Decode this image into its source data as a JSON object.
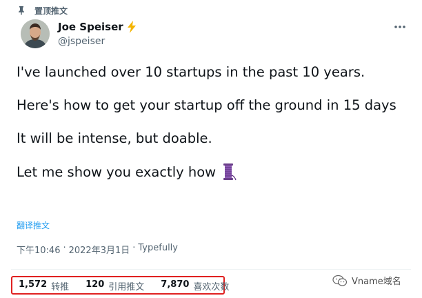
{
  "pinned": {
    "label": "置顶推文"
  },
  "author": {
    "name": "Joe Speiser",
    "handle": "@jspeiser"
  },
  "tweet": {
    "paragraphs": [
      "I've launched over 10 startups in the past 10 years.",
      "Here's how to get your startup off the ground in 15 days",
      "It will be intense, but doable.",
      "Let me show you exactly how"
    ],
    "translate_label": "翻译推文"
  },
  "meta": {
    "time": "下午10:46",
    "separator": "·",
    "date": "2022年3月1日",
    "source": "Typefully"
  },
  "stats": [
    {
      "count": "1,572",
      "label": "转推"
    },
    {
      "count": "120",
      "label": "引用推文"
    },
    {
      "count": "7,870",
      "label": "喜欢次数"
    }
  ],
  "watermark": {
    "text": "Vname域名"
  },
  "icons": {
    "pin": "pin-icon",
    "verified_badge": "lightning-bolt-icon",
    "more": "more-horizontal-icon",
    "thread": "thread-spool-icon",
    "watermark_logo": "wechat-icon"
  },
  "colors": {
    "link": "#1d9bf0",
    "secondary": "#536471",
    "highlight_border": "#e02020",
    "bolt": "#f4b400"
  }
}
